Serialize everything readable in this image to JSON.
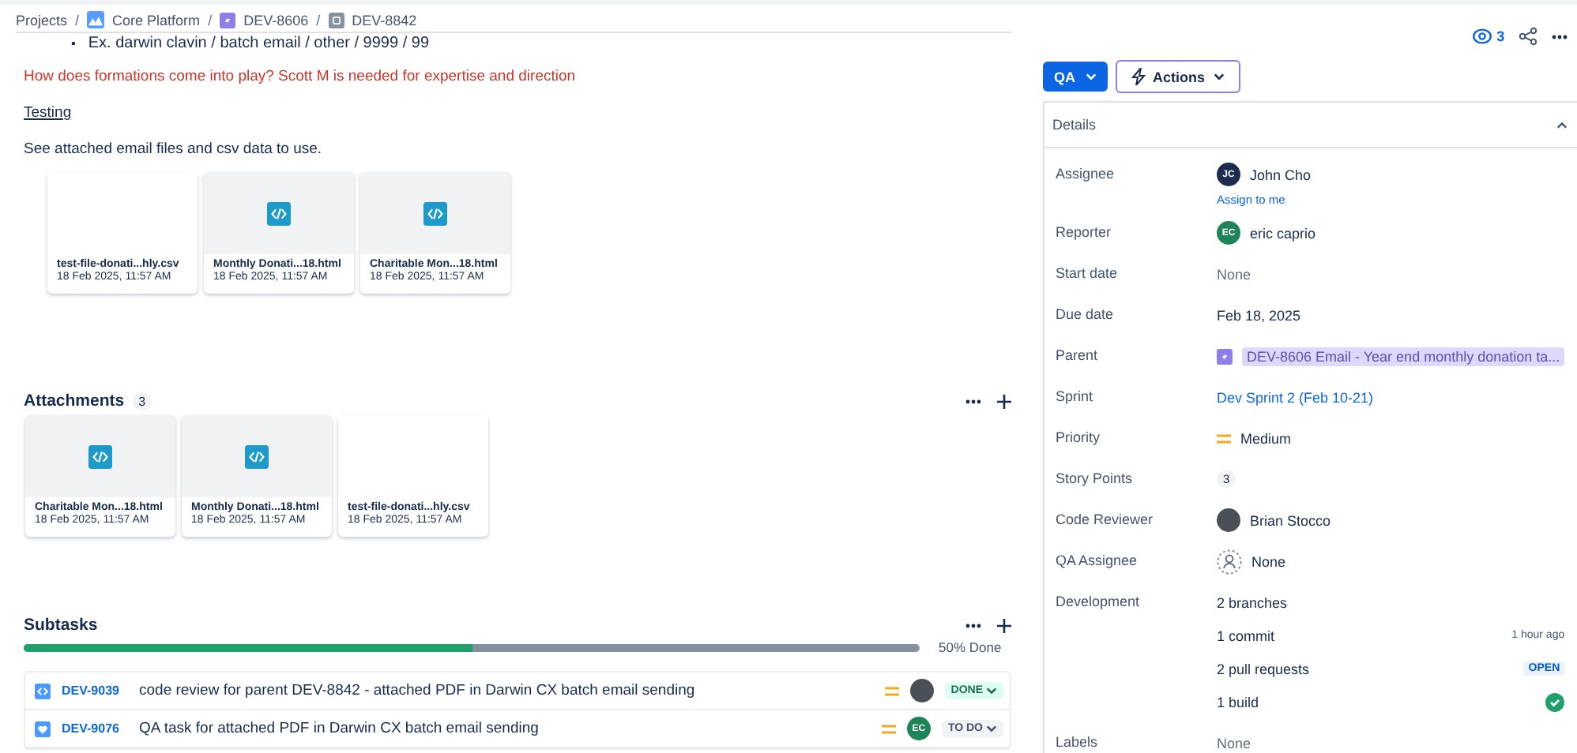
{
  "breadcrumb": {
    "separator": "/",
    "items": [
      {
        "label": "Projects",
        "kind": "plain"
      },
      {
        "label": "Core Platform",
        "kind": "project"
      },
      {
        "label": "DEV-8606",
        "kind": "epic"
      },
      {
        "label": "DEV-8842",
        "kind": "task"
      }
    ]
  },
  "description": {
    "bullet_marker": "▪",
    "bullet": "Ex. darwin clavin / batch email / other / 9999 / 99",
    "warning": "How does formations come into play? Scott M is needed for expertise and direction",
    "heading": "Testing",
    "paragraph": "See attached email files and csv data to use.",
    "files": [
      {
        "name": "test-file-donati...hly.csv",
        "date": "18 Feb 2025, 11:57 AM",
        "kind": "csv"
      },
      {
        "name": "Monthly Donati...18.html",
        "date": "18 Feb 2025, 11:57 AM",
        "kind": "html"
      },
      {
        "name": "Charitable Mon...18.html",
        "date": "18 Feb 2025, 11:57 AM",
        "kind": "html"
      }
    ]
  },
  "attachments": {
    "title": "Attachments",
    "count": "3",
    "files": [
      {
        "name": "Charitable Mon...18.html",
        "date": "18 Feb 2025, 11:57 AM",
        "kind": "html"
      },
      {
        "name": "Monthly Donati...18.html",
        "date": "18 Feb 2025, 11:57 AM",
        "kind": "html"
      },
      {
        "name": "test-file-donati...hly.csv",
        "date": "18 Feb 2025, 11:57 AM",
        "kind": "csv"
      }
    ]
  },
  "subtasks": {
    "title": "Subtasks",
    "level": 0.5,
    "progress_label": "50% Done",
    "items": [
      {
        "key": "DEV-9039",
        "summary": "code review for parent DEV-8842 - attached PDF in Darwin CX batch email sending",
        "kind": "review",
        "avatar": {
          "kind": "photo"
        },
        "status": "DONE",
        "done": true
      },
      {
        "key": "DEV-9076",
        "summary": "QA task for attached PDF in Darwin CX batch email sending",
        "kind": "qa",
        "avatar": {
          "kind": "initials",
          "initials": "EC",
          "color": "#1f845a"
        },
        "status": "TO DO",
        "done": false
      }
    ]
  },
  "header_actions": {
    "watchers": "3"
  },
  "status_button": "QA",
  "actions_button": "Actions",
  "details": {
    "title": "Details",
    "expanded": true,
    "fields": [
      {
        "label": "Assignee",
        "kind": "user",
        "value": "John Cho",
        "avatar": {
          "kind": "initials",
          "initials": "JC",
          "color": "#1d2b4f"
        },
        "link": "Assign to me"
      },
      {
        "label": "Reporter",
        "kind": "user",
        "value": "eric caprio",
        "avatar": {
          "kind": "initials",
          "initials": "EC",
          "color": "#1f845a"
        }
      },
      {
        "label": "Start date",
        "kind": "muted",
        "value": "None"
      },
      {
        "label": "Due date",
        "kind": "text",
        "value": "Feb 18, 2025"
      },
      {
        "label": "Parent",
        "kind": "parent",
        "value": "DEV-8606 Email - Year end monthly donation ta..."
      },
      {
        "label": "Sprint",
        "kind": "link",
        "value": "Dev Sprint 2 (Feb 10-21)"
      },
      {
        "label": "Priority",
        "kind": "priority",
        "value": "Medium"
      },
      {
        "label": "Story Points",
        "kind": "badge",
        "value": "3"
      },
      {
        "label": "Code Reviewer",
        "kind": "user",
        "value": "Brian Stocco",
        "avatar": {
          "kind": "photo"
        }
      },
      {
        "label": "QA Assignee",
        "kind": "user",
        "value": "None",
        "avatar": {
          "kind": "empty"
        }
      },
      {
        "label": "Development",
        "kind": "development",
        "items": [
          {
            "text": "2 branches",
            "kind": "plain"
          },
          {
            "text": "1 commit",
            "kind": "time",
            "extra": "1 hour ago"
          },
          {
            "text": "2 pull requests",
            "kind": "lozenge",
            "extra": "OPEN"
          },
          {
            "text": "1 build",
            "kind": "success"
          }
        ]
      },
      {
        "label": "Labels",
        "kind": "muted",
        "value": "None"
      }
    ]
  }
}
